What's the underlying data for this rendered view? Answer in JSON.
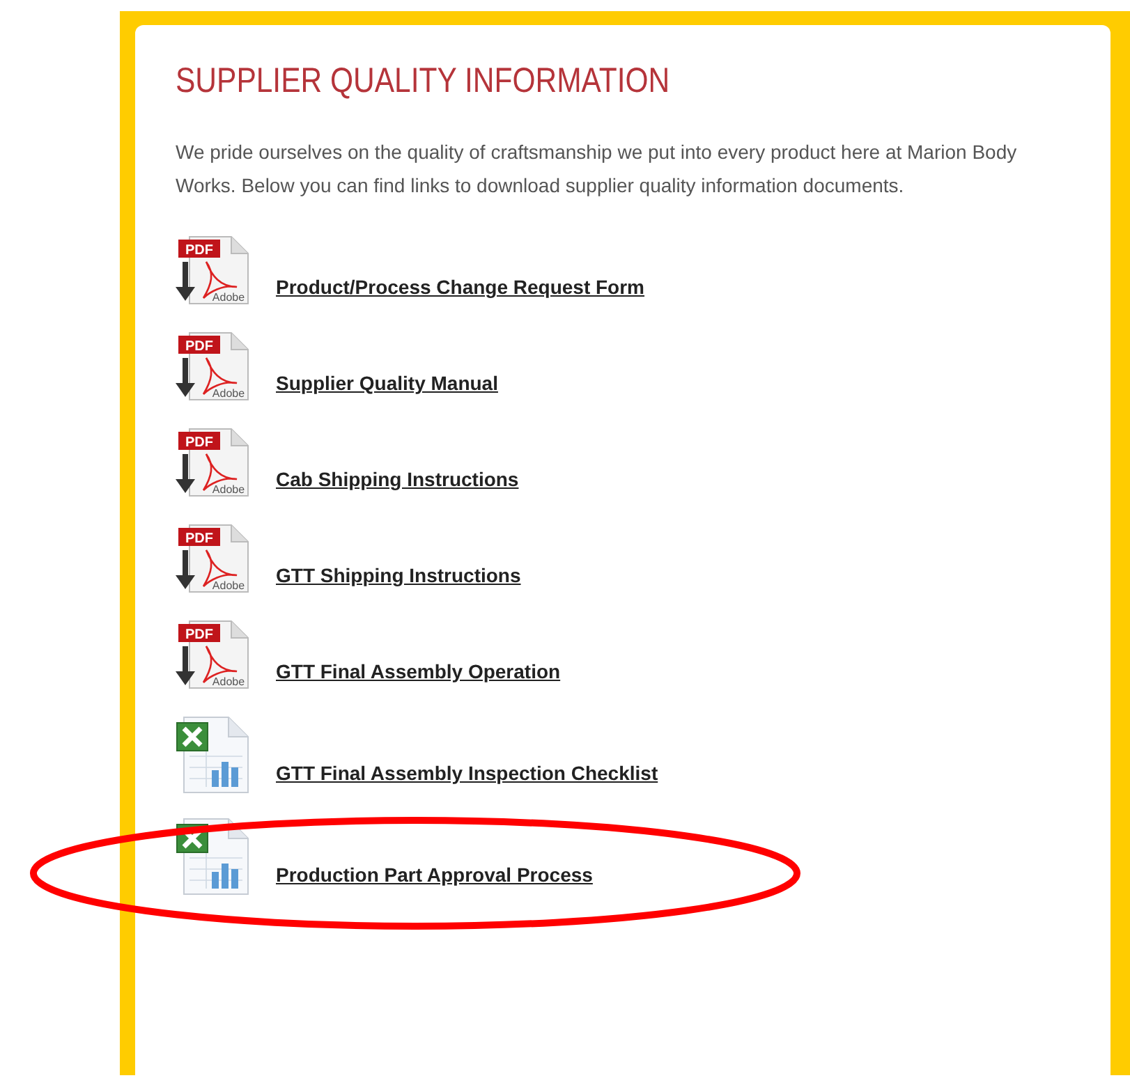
{
  "heading": "SUPPLIER QUALITY INFORMATION",
  "intro": "We pride ourselves on the quality of craftsmanship we put into every product here at Marion Body Works. Below you can find links to download supplier quality information documents.",
  "documents": [
    {
      "kind": "pdf",
      "badge": "PDF",
      "brand": "Adobe",
      "title": "Product/Process Change Request Form",
      "circled": false
    },
    {
      "kind": "pdf",
      "badge": "PDF",
      "brand": "Adobe",
      "title": "Supplier Quality Manual",
      "circled": false
    },
    {
      "kind": "pdf",
      "badge": "PDF",
      "brand": "Adobe",
      "title": "Cab Shipping Instructions",
      "circled": false
    },
    {
      "kind": "pdf",
      "badge": "PDF",
      "brand": "Adobe",
      "title": "GTT Shipping Instructions",
      "circled": false
    },
    {
      "kind": "pdf",
      "badge": "PDF",
      "brand": "Adobe",
      "title": "GTT Final Assembly Operation",
      "circled": false
    },
    {
      "kind": "excel",
      "title": "GTT Final Assembly Inspection Checklist",
      "circled": false
    },
    {
      "kind": "excel",
      "title": "Production Part Approval Process",
      "circled": true
    }
  ]
}
